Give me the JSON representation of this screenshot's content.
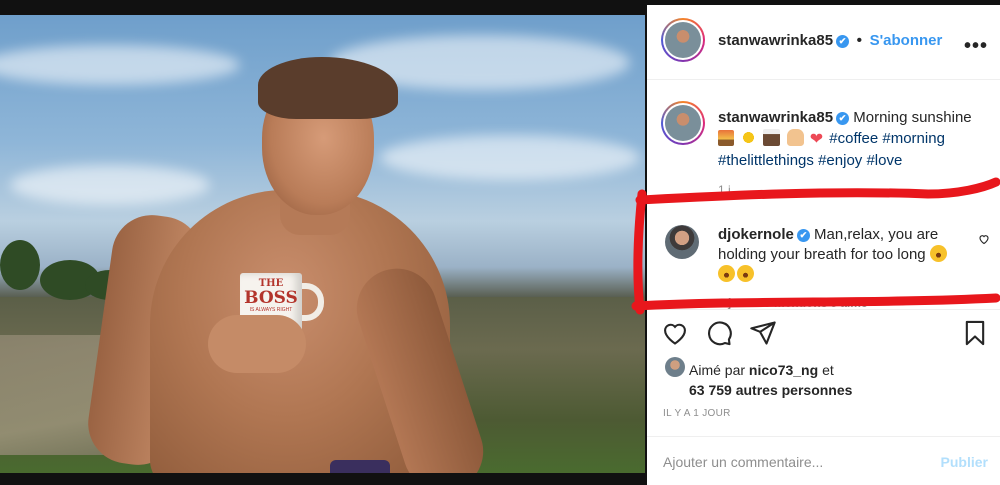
{
  "post": {
    "username": "stanwawrinka85",
    "verified_mark": "✔",
    "follow_label": "S'abonner",
    "more_icon": "•••"
  },
  "photo": {
    "mug_line1": "THE",
    "mug_line2": "BOSS",
    "mug_line3": "IS ALWAYS RIGHT"
  },
  "caption": {
    "username": "stanwawrinka85",
    "text": "Morning sunshine",
    "hashtags": [
      "#coffee",
      "#morning",
      "#thelittlethings",
      "#enjoy",
      "#love"
    ],
    "time": "1 j"
  },
  "comment": {
    "username": "djokernole",
    "text": "Man,relax, you are holding your breath for too long",
    "time": "1 j",
    "likes": "4 299 mentions J'aime"
  },
  "likes": {
    "prefix": "Aimé par",
    "user": "nico73_ng",
    "joiner": "et",
    "others": "63 759 autres personnes"
  },
  "timestamp": "IL Y A 1 JOUR",
  "comment_box": {
    "placeholder": "Ajouter un commentaire...",
    "publish_label": "Publier"
  },
  "colors": {
    "link_blue": "#3897f0",
    "hashtag": "#003569",
    "annotation_red": "#e8171c"
  }
}
